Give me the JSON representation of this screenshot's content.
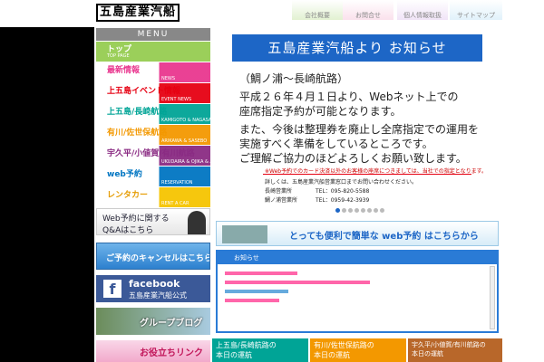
{
  "header": {
    "logo": "五島産業汽船",
    "nav": [
      {
        "label": "会社概要",
        "color": "#cfe8b3"
      },
      {
        "label": "お問合せ",
        "color": "#f7cde0"
      },
      {
        "label": "個人情報取扱",
        "color": "#e7d2f2"
      },
      {
        "label": "サイトマップ",
        "color": "#cde9f8"
      }
    ]
  },
  "sidebar": {
    "menu_title": "MENU",
    "items": [
      {
        "label": "トップ",
        "sub": "TOP PAGE",
        "color": "#9bcf5a",
        "text_color": "#fff"
      },
      {
        "label": "最新情報",
        "sub": "NEWS",
        "color": "#e9378f",
        "text_color": "#e9378f"
      },
      {
        "label": "上五島イベント情報",
        "sub": "EVENT NEWS",
        "color": "#e60012",
        "text_color": "#e60012"
      },
      {
        "label": "上五島/長崎航路",
        "sub": "KAMIGOTO & NAGASAKI",
        "color": "#00a496",
        "text_color": "#00a496"
      },
      {
        "label": "有川/佐世保航路",
        "sub": "ARIKAWA & SASEBO",
        "color": "#f39800",
        "text_color": "#f39800"
      },
      {
        "label": "宇久平/小値賀/有川航路",
        "sub": "UKUDAIRA & OJIKA & ARIKAWA",
        "color": "#8a2b83",
        "text_color": "#8a2b83"
      },
      {
        "label": "web予約",
        "sub": "RESERVATION",
        "color": "#0075c2",
        "text_color": "#0075c2"
      },
      {
        "label": "レンタカー",
        "sub": "RENT A CAR",
        "color": "#f5c400",
        "text_color": "#e59b00"
      }
    ],
    "banners": {
      "qa_line1": "Web予約に関する",
      "qa_line2": "Q&Aはこちら",
      "cancel": "ご予約のキャンセルはこちら",
      "facebook_title": "facebook",
      "facebook_sub": "五島産業汽船公式",
      "group_blog": "グループブログ",
      "useful_links": "お役立ちリンク"
    }
  },
  "notice": {
    "title": "五島産業汽船より お知らせ",
    "route": "（鯛ノ浦～長崎航路）",
    "lines": [
      "平成２６年４月１日より、Webネット上での",
      "座席指定予約が可能となります。",
      "また、今後は整理券を廃止し全席指定での運用を",
      "実施すべく準備をしているところです。",
      "ご理解ご協力のほどよろしくお願い致します。"
    ],
    "note": "※Web予約でのカード決済以外のお客様の座席につきましては、当社での指定となります。",
    "contact_intro": "詳しくは、五島産業汽船営業窓口までお問い合わせください。",
    "offices": [
      {
        "name": "長崎営業所",
        "tel": "TEL：095-820-5588"
      },
      {
        "name": "鯛ノ浦営業所",
        "tel": "TEL：0959-42-3939"
      }
    ]
  },
  "web_banner": "とっても便利で簡単な web予約 はこちらから",
  "info": {
    "heading": "お知らせ"
  },
  "routes": [
    {
      "line1": "上五島/長崎航路の",
      "line2": "本日の運航",
      "color": "#00a496"
    },
    {
      "line1": "有川/佐世保航路の",
      "line2": "本日の運航",
      "color": "#f39800"
    },
    {
      "line1": "宇久平/小値賀/有川航路の",
      "line2": "本日の運航",
      "color": "#b8672a"
    }
  ]
}
